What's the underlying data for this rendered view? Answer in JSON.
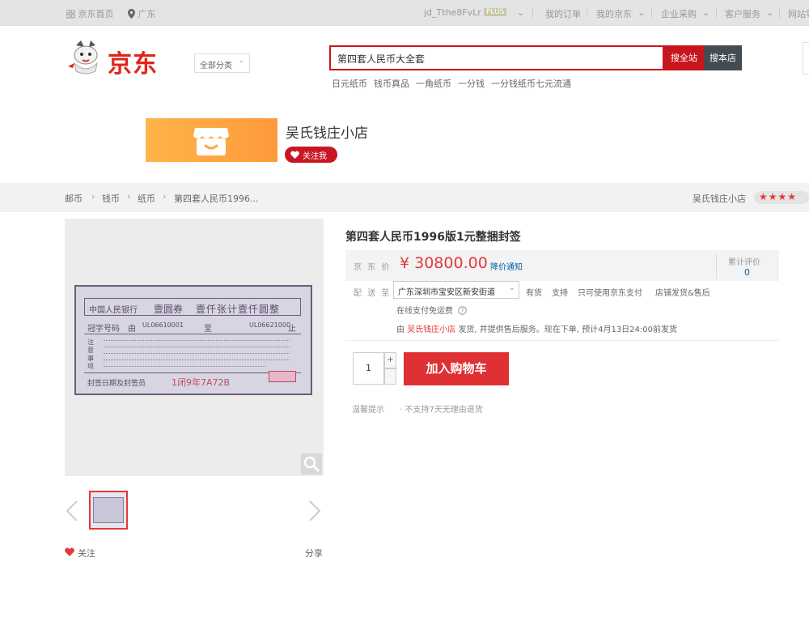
{
  "topbar": {
    "home": "京东首页",
    "location": "广东",
    "username": "jd_Tthe8FvLr",
    "plus": "PLUS",
    "my_orders": "我的订单",
    "my_jd": "我的京东",
    "enterprise": "企业采购",
    "customer_service": "客户服务",
    "site_nav": "网站导航"
  },
  "header": {
    "logo": "京东",
    "category": "全部分类",
    "search_value": "第四套人民币大全套",
    "search_all_jd": "搜全站",
    "search_store": "搜本店",
    "hot_words": [
      "日元纸币",
      "钱币真品",
      "一角纸币",
      "一分钱",
      "一分钱纸币七元流通"
    ]
  },
  "shop": {
    "name": "吴氏钱庄小店",
    "follow": "关注我"
  },
  "breadcrumb": {
    "items": [
      "邮币",
      "钱币",
      "纸币",
      "第四套人民币1996..."
    ],
    "shop_short": "吴氏钱庄小店"
  },
  "product": {
    "title": "第四套人民币1996版1元整捆封签",
    "price_label": "京 东 价",
    "price": "¥ 30800.00",
    "price_notify": "降价通知",
    "review_label": "累计评价",
    "review_count": "0",
    "ship_label": "配 送 至",
    "address": "广东深圳市宝安区新安街道",
    "services": [
      "有货",
      "支持",
      "只可使用京东支付",
      "店铺发货&售后"
    ],
    "services_line2": "在线支付免运费",
    "ship_prefix": "由",
    "ship_shop": "吴氏钱庄小店",
    "ship_suffix": "发货, 并提供售后服务。现在下单, 预计4月13日24:00前发货",
    "qty": "1",
    "qty_plus": "+",
    "qty_minus": "-",
    "add_to_cart": "加入购物车",
    "tip_label": "温馨提示",
    "tip_value": "· 不支持7天无理由退货"
  },
  "gallery": {
    "follow": "关注",
    "share": "分享"
  },
  "ticket": {
    "bank": "中国人民银行",
    "denom": "壹圆券",
    "qty_text": "壹仟张计壹仟圆整",
    "serial_label": "冠字号码",
    "from": "由",
    "serial_from": "UL06610001",
    "to": "至",
    "serial_to": "UL06621000",
    "end": "止",
    "note": "注意事项",
    "stamp_label": "封签日期及封签员",
    "stamp_code": "1闭9年7A72B"
  },
  "colors": {
    "brand_red": "#e1251b",
    "cart_red": "#df3033",
    "link_blue": "#005ea7"
  }
}
